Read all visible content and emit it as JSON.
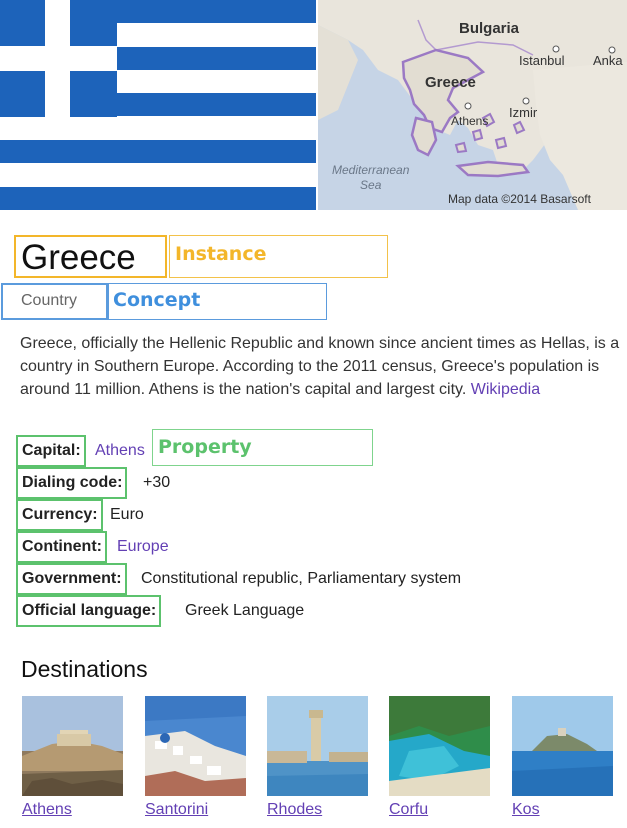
{
  "map": {
    "labels": {
      "bulgaria": "Bulgaria",
      "istanbul": "Istanbul",
      "ankara": "Anka",
      "greece": "Greece",
      "athens": "Athens",
      "izmir": "Izmir",
      "sea_line1": "Mediterranean",
      "sea_line2": "Sea",
      "credit": "Map data ©2014 Basarsoft"
    }
  },
  "entity": {
    "title": "Greece",
    "type": "Country",
    "description": "Greece, officially the Hellenic Republic and known since ancient times as Hellas, is a country in Southern Europe. According to the 2011 census, Greece's population is around 11 million. Athens is the nation's capital and largest city.",
    "source_link": "Wikipedia"
  },
  "annotations": {
    "instance": "Instance",
    "concept": "Concept",
    "property": "Property",
    "colors": {
      "instance": "#f3b62a",
      "concept": "#3f8fdd",
      "property": "#5cc26d"
    }
  },
  "properties": [
    {
      "key": "Capital:",
      "value": "Athens"
    },
    {
      "key": "Dialing code:",
      "value": "+30"
    },
    {
      "key": "Currency:",
      "value": "Euro"
    },
    {
      "key": "Continent:",
      "value": "Europe"
    },
    {
      "key": "Government:",
      "value": "Constitutional republic, Parliamentary system"
    },
    {
      "key": "Official language:",
      "value": "Greek Language"
    }
  ],
  "destinations": {
    "heading": "Destinations",
    "items": [
      "Athens",
      "Santorini",
      "Rhodes",
      "Corfu",
      "Kos"
    ]
  },
  "colors": {
    "link": "#6340b4",
    "flag_blue": "#1d63ba"
  }
}
